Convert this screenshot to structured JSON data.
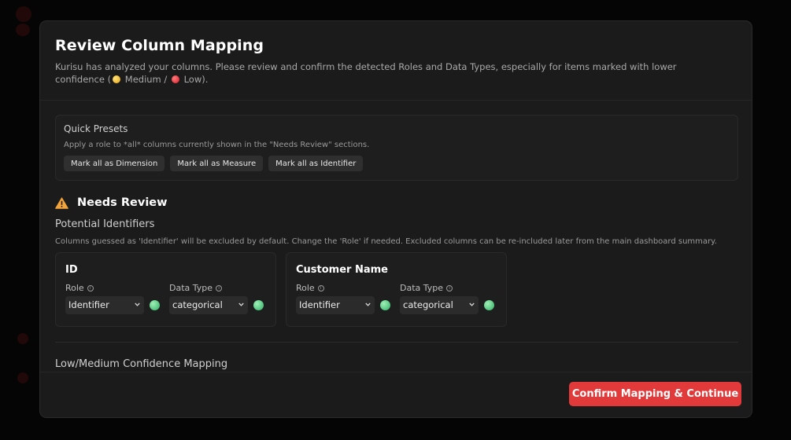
{
  "modal": {
    "title": "Review Column Mapping",
    "subtitle_prefix": "Kurisu has analyzed your columns. Please review and confirm the detected Roles and Data Types, especially for items marked with lower confidence (",
    "subtitle_medium": "Medium /",
    "subtitle_low": "Low).",
    "colors": {
      "accent": "#e23a3a",
      "confidence_high": "#3ecf7a",
      "confidence_medium": "#f2c230",
      "confidence_low": "#e3303a"
    }
  },
  "presets": {
    "title": "Quick Presets",
    "description": "Apply a role to *all* columns currently shown in the \"Needs Review\" sections.",
    "buttons": [
      "Mark all as Dimension",
      "Mark all as Measure",
      "Mark all as Identifier"
    ]
  },
  "needs_review": {
    "title": "Needs Review",
    "icon": "warning-icon",
    "identifiers": {
      "title": "Potential Identifiers",
      "description": "Columns guessed as 'Identifier' will be excluded by default. Change the 'Role' if needed. Excluded columns can be re-included later from the main dashboard summary.",
      "cards": [
        {
          "name": "ID",
          "role_label": "Role",
          "role_value": "Identifier",
          "type_label": "Data Type",
          "type_value": "categorical"
        },
        {
          "name": "Customer Name",
          "role_label": "Role",
          "role_value": "Identifier",
          "type_label": "Data Type",
          "type_value": "categorical"
        }
      ]
    },
    "low_medium": {
      "title": "Low/Medium Confidence Mapping"
    }
  },
  "footer": {
    "confirm_label": "Confirm Mapping & Continue"
  }
}
